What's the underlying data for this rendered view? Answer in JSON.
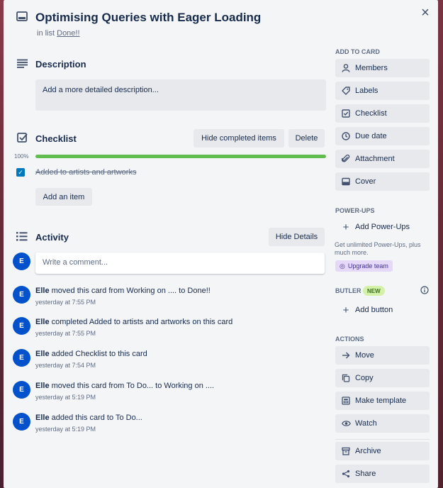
{
  "card": {
    "title": "Optimising Queries with Eager Loading",
    "in_list_prefix": "in list",
    "list_name": "Done!!",
    "close_glyph": "×"
  },
  "description": {
    "heading": "Description",
    "placeholder": "Add a more detailed description..."
  },
  "checklist": {
    "heading": "Checklist",
    "hide_completed_label": "Hide completed items",
    "delete_label": "Delete",
    "progress_label": "100%",
    "progress_fraction": 1.0,
    "items": [
      {
        "text": "Added to artists and artworks",
        "checked": true
      }
    ],
    "add_item_label": "Add an item"
  },
  "activity": {
    "heading": "Activity",
    "hide_details_label": "Hide Details",
    "avatar_initial": "E",
    "comment_placeholder": "Write a comment...",
    "entries": [
      {
        "user": "Elle",
        "text": "moved this card from Working on .... to Done!!",
        "time": "yesterday at 7:55 PM"
      },
      {
        "user": "Elle",
        "text": "completed Added to artists and artworks on this card",
        "time": "yesterday at 7:55 PM"
      },
      {
        "user": "Elle",
        "text": "added Checklist to this card",
        "time": "yesterday at 7:54 PM"
      },
      {
        "user": "Elle",
        "text": "moved this card from To Do... to Working on ....",
        "time": "yesterday at 5:19 PM"
      },
      {
        "user": "Elle",
        "text": "added this card to To Do...",
        "time": "yesterday at 5:19 PM"
      }
    ]
  },
  "sidebar": {
    "add_to_card_heading": "ADD TO CARD",
    "add_to_card": [
      "Members",
      "Labels",
      "Checklist",
      "Due date",
      "Attachment",
      "Cover"
    ],
    "powerups_heading": "POWER-UPS",
    "add_powerups_label": "Add Power-Ups",
    "powerups_note": "Get unlimited Power-Ups, plus much more.",
    "upgrade_label": "Upgrade team",
    "butler_heading": "BUTLER",
    "butler_badge": "NEW",
    "add_button_label": "Add button",
    "actions_heading": "ACTIONS",
    "actions": [
      "Move",
      "Copy",
      "Make template",
      "Watch",
      "Archive",
      "Share"
    ]
  },
  "colors": {
    "accent_blue": "#0079bf",
    "progress_green": "#61bd4f",
    "avatar_blue": "#0052cc"
  }
}
